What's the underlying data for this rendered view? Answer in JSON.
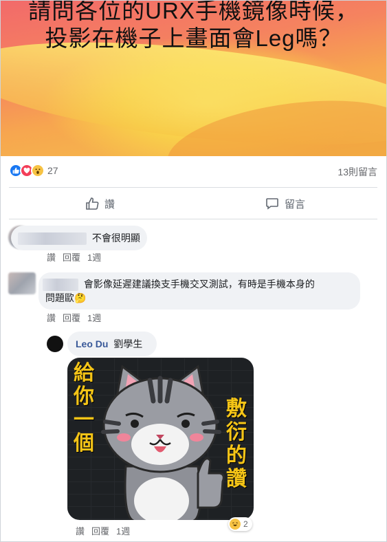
{
  "post": {
    "title_line1": "請問各位的URX手機鏡像時候，",
    "title_line2": "投影在機子上畫面會Leg嗎？"
  },
  "reactions": {
    "icons": [
      "like-icon",
      "love-icon",
      "wow-icon"
    ],
    "count": "27",
    "comments_count": "13則留言"
  },
  "actions": {
    "like_label": "讚",
    "comment_label": "留言"
  },
  "comments": [
    {
      "text": "不會很明顯",
      "like": "讚",
      "reply": "回覆",
      "time": "1週"
    },
    {
      "text_line1": "會影像延遲建議換支手機交叉測試，有時是手機本身的",
      "text_line2": "問題歐",
      "emoji": "🤔",
      "like": "讚",
      "reply": "回覆",
      "time": "1週"
    },
    {
      "author": "Leo Du",
      "text": "劉學生",
      "sticker_text_left": [
        "給",
        "你",
        "一",
        "個"
      ],
      "sticker_text_right": [
        "敷",
        "衍",
        "的",
        "讚"
      ],
      "reaction_count": "2",
      "like": "讚",
      "reply": "回覆",
      "time": "1週"
    }
  ],
  "colors": {
    "like_blue": "#1877f2",
    "love_red": "#f33e58",
    "wow_yellow": "#f7c344",
    "author_blue": "#385898"
  }
}
